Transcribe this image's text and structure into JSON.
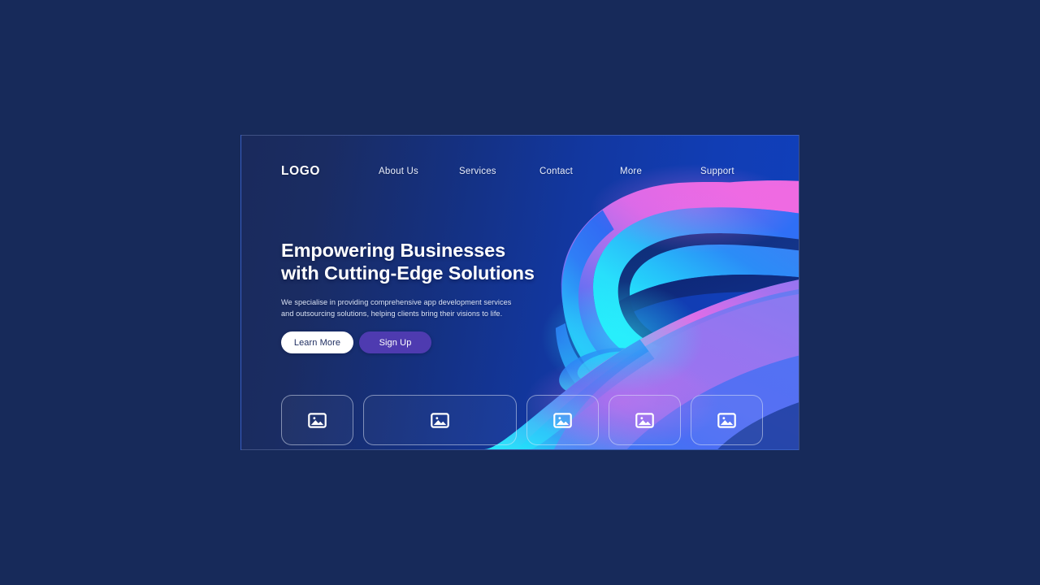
{
  "page": {
    "background_color": "#172a5a",
    "panel_gradient_from": "#1a2a5c",
    "panel_gradient_to": "#1040bd"
  },
  "header": {
    "logo": "LOGO",
    "nav": [
      {
        "label": "About Us"
      },
      {
        "label": "Services"
      },
      {
        "label": "Contact"
      },
      {
        "label": "More"
      },
      {
        "label": "Support"
      }
    ]
  },
  "hero": {
    "headline_line1": "Empowering Businesses",
    "headline_line2": "with Cutting-Edge Solutions",
    "subtext": "We specialise in providing comprehensive app development services and outsourcing solutions, helping clients bring their visions to life.",
    "buttons": [
      {
        "label": "Learn More",
        "style": "light",
        "bg": "#ffffff",
        "fg": "#1b2a5e"
      },
      {
        "label": "Sign Up",
        "style": "purple",
        "bg": "#4e3bb0",
        "fg": "#ffffff"
      }
    ]
  },
  "cards": [
    {
      "icon": "image-placeholder-icon",
      "size": "small"
    },
    {
      "icon": "image-placeholder-icon",
      "size": "wide"
    },
    {
      "icon": "image-placeholder-icon",
      "size": "small"
    },
    {
      "icon": "image-placeholder-icon",
      "size": "small"
    },
    {
      "icon": "image-placeholder-icon",
      "size": "small"
    }
  ],
  "artwork": {
    "name": "abstract-3d-ribbon",
    "colors": {
      "magenta": "#ef66e0",
      "pink": "#e87fe8",
      "purple": "#8a6ff0",
      "violet": "#7b6cf2",
      "blue": "#2a6ef5",
      "bright_blue": "#1e8ef8",
      "cyan": "#22e4fc",
      "aqua": "#35d8fb",
      "shadow_navy": "#0f2d80",
      "deep_navy": "#102a6e"
    }
  }
}
